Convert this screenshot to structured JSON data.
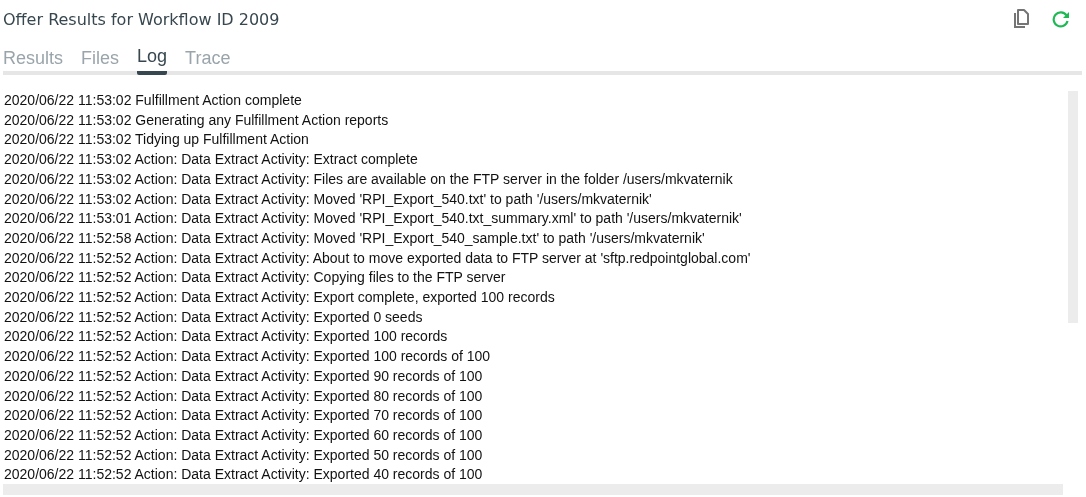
{
  "window": {
    "title": "Offer Results for Workflow ID 2009"
  },
  "tabs": [
    {
      "label": "Results",
      "selected": false
    },
    {
      "label": "Files",
      "selected": false
    },
    {
      "label": "Log",
      "selected": true
    },
    {
      "label": "Trace",
      "selected": false
    }
  ],
  "log": [
    "2020/06/22 11:53:02 Fulfillment Action complete",
    "2020/06/22 11:53:02 Generating any Fulfillment Action reports",
    "2020/06/22 11:53:02 Tidying up Fulfillment Action",
    "2020/06/22 11:53:02 Action: Data Extract Activity: Extract complete",
    "2020/06/22 11:53:02 Action: Data Extract Activity: Files are available on the FTP server in the folder /users/mkvaternik",
    "2020/06/22 11:53:02 Action: Data Extract Activity: Moved 'RPI_Export_540.txt' to path '/users/mkvaternik'",
    "2020/06/22 11:53:01 Action: Data Extract Activity: Moved 'RPI_Export_540.txt_summary.xml' to path '/users/mkvaternik'",
    "2020/06/22 11:52:58 Action: Data Extract Activity: Moved 'RPI_Export_540_sample.txt' to path '/users/mkvaternik'",
    "2020/06/22 11:52:52 Action: Data Extract Activity: About to move exported data to FTP server at 'sftp.redpointglobal.com'",
    "2020/06/22 11:52:52 Action: Data Extract Activity: Copying files to the FTP server",
    "2020/06/22 11:52:52 Action: Data Extract Activity: Export complete, exported 100 records",
    "2020/06/22 11:52:52 Action: Data Extract Activity: Exported 0 seeds",
    "2020/06/22 11:52:52 Action: Data Extract Activity: Exported 100 records",
    "2020/06/22 11:52:52 Action: Data Extract Activity: Exported 100 records of 100",
    "2020/06/22 11:52:52 Action: Data Extract Activity: Exported 90 records of 100",
    "2020/06/22 11:52:52 Action: Data Extract Activity: Exported 80 records of 100",
    "2020/06/22 11:52:52 Action: Data Extract Activity: Exported 70 records of 100",
    "2020/06/22 11:52:52 Action: Data Extract Activity: Exported 60 records of 100",
    "2020/06/22 11:52:52 Action: Data Extract Activity: Exported 50 records of 100",
    "2020/06/22 11:52:52 Action: Data Extract Activity: Exported 40 records of 100"
  ]
}
